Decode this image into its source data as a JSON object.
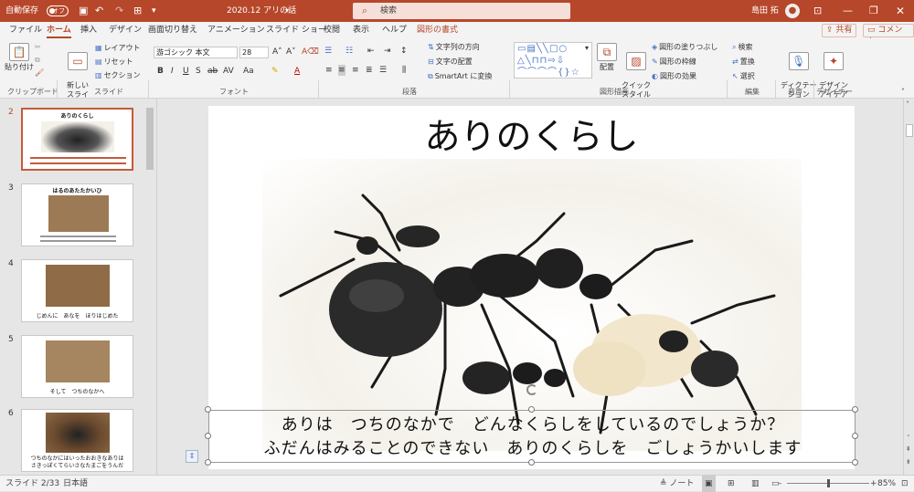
{
  "titlebar": {
    "autosave_label": "自動保存",
    "autosave_state": "オフ",
    "doc_title": "2020.12 アリの話",
    "search_placeholder": "検索",
    "user_name": "島田 拓"
  },
  "tabs": [
    "ファイル",
    "ホーム",
    "挿入",
    "デザイン",
    "画面切り替え",
    "アニメーション",
    "スライド ショー",
    "校閲",
    "表示",
    "ヘルプ",
    "図形の書式"
  ],
  "share_label": "共有",
  "comment_label": "コメント",
  "ribbon": {
    "clipboard": {
      "paste": "貼り付け",
      "group": "クリップボード"
    },
    "slides": {
      "new_slide": "新しい\nスライド",
      "layout": "レイアウト",
      "reset": "リセット",
      "section": "セクション",
      "group": "スライド"
    },
    "font": {
      "font_name": "游ゴシック 本文",
      "font_size": "28",
      "group": "フォント"
    },
    "paragraph": {
      "text_direction": "文字列の方向",
      "align_text": "文字の配置",
      "smartart": "SmartArt に変換",
      "group": "段落"
    },
    "drawing": {
      "arrange": "配置",
      "quick_styles": "クイック\nスタイル",
      "fill": "図形の塗りつぶし",
      "outline": "図形の枠線",
      "effects": "図形の効果",
      "group": "図形描画"
    },
    "editing": {
      "find": "検索",
      "replace": "置換",
      "select": "選択",
      "group": "編集"
    },
    "voice": {
      "dictate": "ディクテー\nション",
      "group": "音声"
    },
    "designer": {
      "ideas": "デザイン\nアイデア",
      "group": "デザイナー"
    }
  },
  "thumbnails": [
    {
      "num": "2",
      "title": "ありのくらし",
      "caption": ""
    },
    {
      "num": "3",
      "title": "はるのあたたかいひ",
      "caption": ""
    },
    {
      "num": "4",
      "title": "",
      "caption": "じめんに　あなを　ほりはじめた"
    },
    {
      "num": "5",
      "title": "",
      "caption": "そして　つちのなかへ"
    },
    {
      "num": "6",
      "title": "",
      "caption": "つちのなかにはいったおおきなありは\nさきっぽくてらいさなたまごをうんだ"
    }
  ],
  "slide": {
    "title": "ありのくらし",
    "line1": "ありは　つちのなかで　どんなくらしをしているのでしょうか？",
    "line2": "ふだんはみることのできない　ありのくらしを　ごしょうかいします"
  },
  "status": {
    "slide_pos": "スライド 2/33",
    "language": "日本語",
    "notes": "ノート",
    "zoom": "85%"
  },
  "colors": {
    "accent": "#b7472a"
  }
}
